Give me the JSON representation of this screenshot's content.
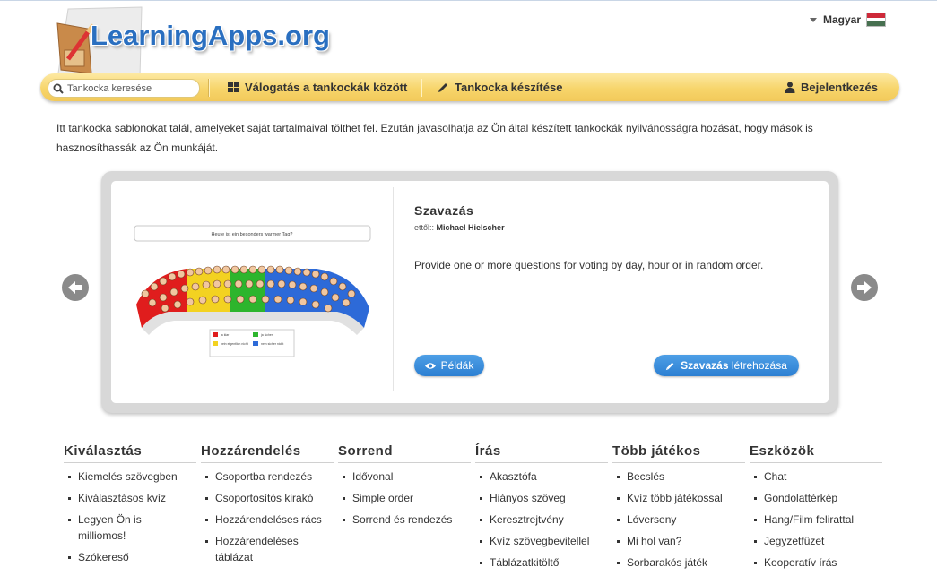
{
  "header": {
    "logo_text": "LearningApps.org",
    "language": "Magyar",
    "flag_colors": [
      "#ce2939",
      "#ffffff",
      "#477050"
    ]
  },
  "nav": {
    "search_placeholder": "Tankocka keresése",
    "browse_label": "Válogatás a tankockák között",
    "create_label": "Tankocka készítése",
    "login_label": "Bejelentkezés"
  },
  "intro": "Itt tankocka sablonokat talál, amelyeket saját tartalmaival tölthet fel. Ezután javasolhatja az Ön által készített tankockák nyilvánosságra hozását, hogy mások is hasznosíthassák az Ön munkáját.",
  "carousel": {
    "title": "Szavazás",
    "by_prefix": "ettől::",
    "author": "Michael Hielscher",
    "description": "Provide one or more questions for voting by day, hour or in random order.",
    "examples_label": "Példák",
    "create_bold": "Szavazás",
    "create_rest": " létrehozása",
    "preview_question": "Heute ist ein besonders warmer Tag?",
    "preview_legend": [
      "ja klar",
      "ja sicher",
      "nein eigentlich nicht",
      "nein sicher nicht"
    ],
    "accent": "#2c7fd2"
  },
  "categories": [
    {
      "title": "Kiválasztás",
      "items": [
        "Kiemelés szövegben",
        "Kiválasztásos kvíz",
        "Legyen Ön is milliomos!",
        "Szókereső"
      ]
    },
    {
      "title": "Hozzárendelés",
      "items": [
        "Csoportba rendezés",
        "Csoportosítós kirakó",
        "Hozzárendeléses rács",
        "Hozzárendeléses táblázat"
      ]
    },
    {
      "title": "Sorrend",
      "items": [
        "Idővonal",
        "Simple order",
        "Sorrend és rendezés"
      ]
    },
    {
      "title": "Írás",
      "items": [
        "Akasztófa",
        "Hiányos szöveg",
        "Keresztrejtvény",
        "Kvíz szövegbevitellel",
        "Táblázatkitöltő"
      ]
    },
    {
      "title": "Több játékos",
      "items": [
        "Becslés",
        "Kvíz több játékossal",
        "Lóverseny",
        "Mi hol van?",
        "Sorbarakós játék"
      ]
    },
    {
      "title": "Eszközök",
      "items": [
        "Chat",
        "Gondolattérkép",
        "Hang/Film felirattal",
        "Jegyzetfüzet",
        "Kooperatív írás"
      ]
    }
  ]
}
